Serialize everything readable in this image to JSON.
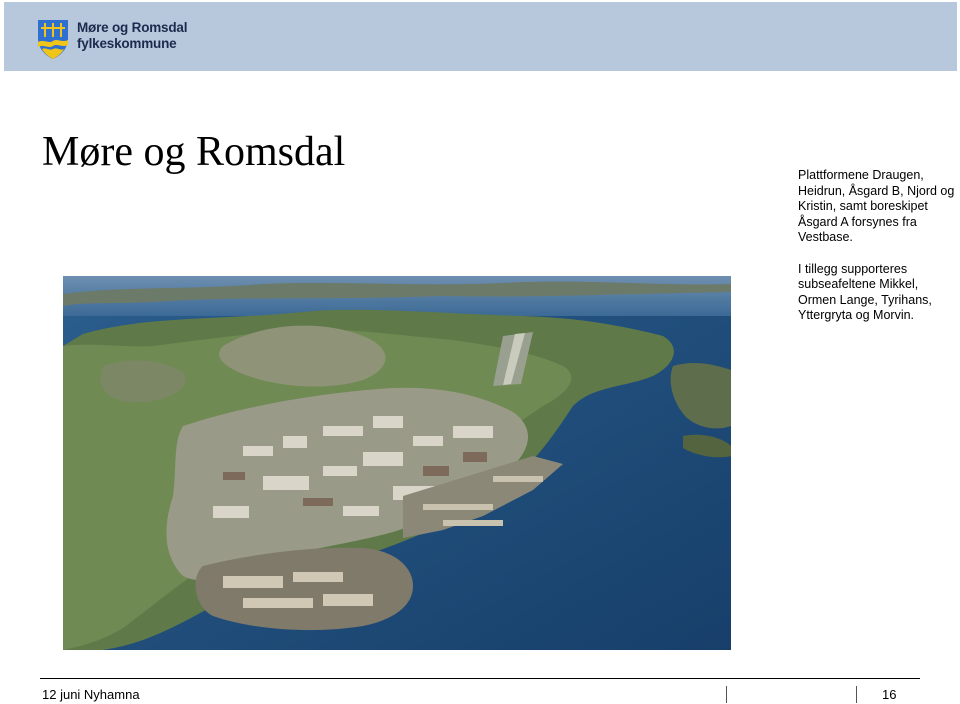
{
  "header": {
    "org_line1": "Møre og Romsdal",
    "org_line2": "fylkeskommune",
    "logo_icon": "county-coat-of-arms-icon",
    "band_color": "#b7c7dc"
  },
  "slide": {
    "title": "Møre og Romsdal",
    "paragraph1": "Plattformene Draugen, Heidrun, Åsgard B, Njord og Kristin, samt boreskipet Åsgard A forsynes fra Vestbase.",
    "paragraph2": "I tillegg supporteres subseafeltene Mikkel, Ormen Lange, Tyrihans, Yttergryta og Morvin."
  },
  "footer": {
    "left_text": "12 juni Nyhamna",
    "page_number": "16"
  }
}
